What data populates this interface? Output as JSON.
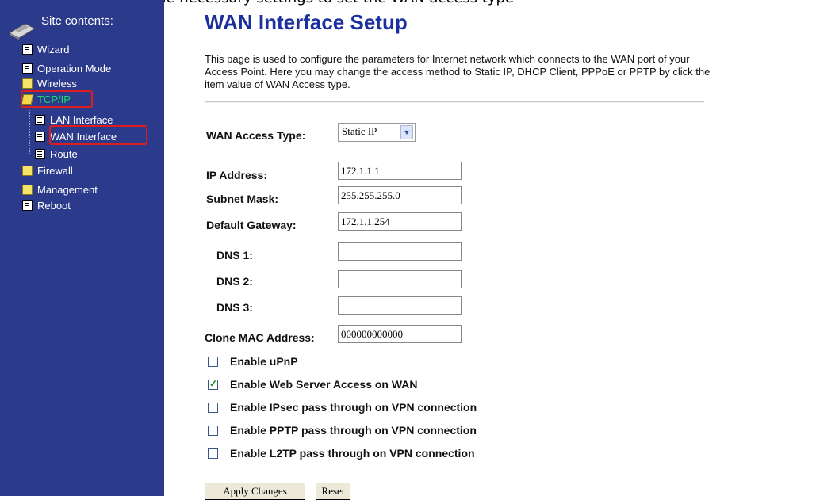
{
  "top_strip": "y you can complete the necessary settings to set the WAN access type",
  "sidebar": {
    "title": "Site contents:",
    "items": [
      {
        "label": "Wizard"
      },
      {
        "label": "Operation Mode"
      },
      {
        "label": "Wireless"
      },
      {
        "label": "TCP/IP"
      },
      {
        "label": "LAN Interface"
      },
      {
        "label": "WAN Interface"
      },
      {
        "label": "Route"
      },
      {
        "label": "Firewall"
      },
      {
        "label": "Management"
      },
      {
        "label": "Reboot"
      }
    ]
  },
  "page": {
    "title": "WAN Interface Setup",
    "description": "This page is used to configure the parameters for Internet network which connects to the WAN port of your Access Point. Here you may change the access method to Static IP, DHCP Client, PPPoE or PPTP by click the item value of WAN Access type."
  },
  "form": {
    "wan_access_type": {
      "label": "WAN Access Type:",
      "value": "Static IP"
    },
    "ip_address": {
      "label": "IP Address:",
      "value": "172.1.1.1"
    },
    "subnet_mask": {
      "label": "Subnet Mask:",
      "value": "255.255.255.0"
    },
    "default_gateway": {
      "label": "Default Gateway:",
      "value": "172.1.1.254"
    },
    "dns1": {
      "label": "DNS 1:",
      "value": ""
    },
    "dns2": {
      "label": "DNS 2:",
      "value": ""
    },
    "dns3": {
      "label": "DNS 3:",
      "value": ""
    },
    "clone_mac": {
      "label": "Clone MAC Address:",
      "value": "000000000000"
    }
  },
  "options": [
    {
      "label": "Enable uPnP",
      "checked": false
    },
    {
      "label": "Enable Web Server Access on WAN",
      "checked": true
    },
    {
      "label": "Enable IPsec pass through on VPN connection",
      "checked": false
    },
    {
      "label": "Enable PPTP pass through on VPN connection",
      "checked": false
    },
    {
      "label": "Enable L2TP pass through on VPN connection",
      "checked": false
    }
  ],
  "buttons": {
    "apply": "Apply Changes",
    "reset": "Reset"
  },
  "colors": {
    "sidebar_bg": "#2c3a8c",
    "title": "#1c2f9e",
    "highlight": "#e01b1b",
    "active_node": "#19e06a"
  }
}
